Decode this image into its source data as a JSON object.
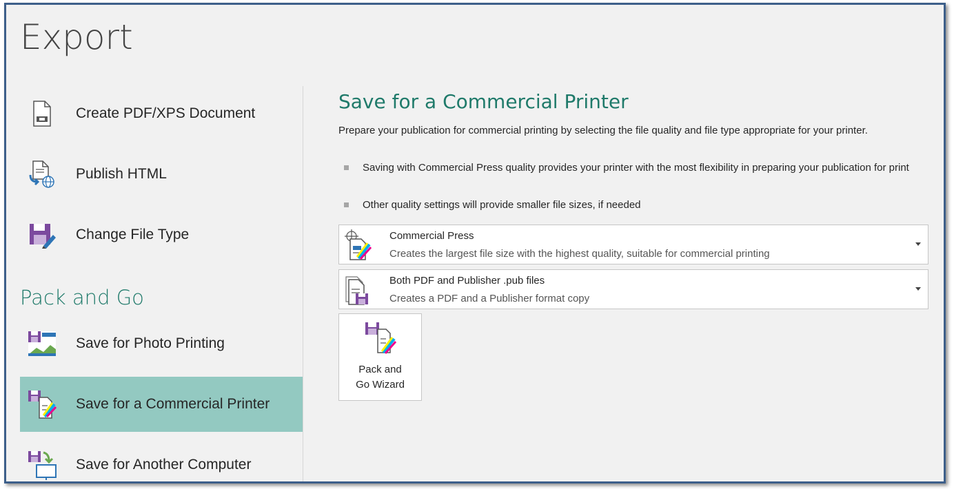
{
  "page_title": "Export",
  "nav": {
    "items": [
      {
        "label": "Create PDF/XPS Document",
        "icon": "pdf-document-icon"
      },
      {
        "label": "Publish HTML",
        "icon": "publish-html-icon"
      },
      {
        "label": "Change File Type",
        "icon": "save-as-icon"
      }
    ],
    "section_header": "Pack and Go",
    "pack_items": [
      {
        "label": "Save for Photo Printing",
        "icon": "photo-printing-icon"
      },
      {
        "label": "Save for a Commercial Printer",
        "icon": "commercial-printer-icon",
        "selected": true
      },
      {
        "label": "Save for Another Computer",
        "icon": "another-computer-icon"
      }
    ]
  },
  "main": {
    "title": "Save for a Commercial Printer",
    "description": "Prepare your publication for commercial printing by selecting the file quality and file type appropriate for your printer.",
    "bullets": [
      "Saving with Commercial Press quality provides your printer with the most flexibility in preparing your publication for print",
      "Other quality settings will provide smaller file sizes, if needed"
    ],
    "quality_dropdown": {
      "title": "Commercial Press",
      "subtitle": "Creates the largest file size with the highest quality, suitable for commercial printing"
    },
    "filetype_dropdown": {
      "title": "Both PDF and Publisher .pub files",
      "subtitle": "Creates a PDF and a Publisher format copy"
    },
    "wizard_button": {
      "label": "Pack and\nGo Wizard"
    }
  },
  "colors": {
    "accent": "#1f7a6a",
    "selected_bg": "#93c9c1",
    "frame_border": "#3d5f8a",
    "background": "#f1f1f1"
  }
}
